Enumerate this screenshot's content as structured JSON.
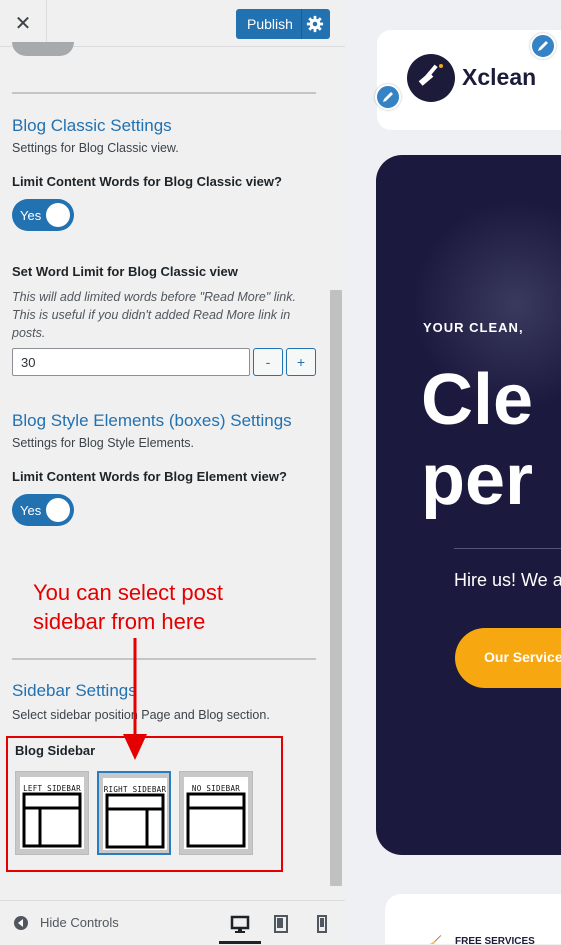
{
  "topbar": {
    "close_glyph": "✕",
    "publish_label": "Publish",
    "gear_icon": "gear-icon"
  },
  "blog_classic": {
    "title": "Blog Classic Settings",
    "description": "Settings for Blog Classic view.",
    "limit_label": "Limit Content Words for Blog Classic view?",
    "limit_toggle": "Yes",
    "word_limit_label": "Set Word Limit for Blog Classic view",
    "word_limit_help_1": "This will add limited words before \"Read More\" link.",
    "word_limit_help_2": "This is useful if you didn't added Read More link in",
    "word_limit_help_3": "posts.",
    "word_limit_value": "30",
    "minus_label": "-",
    "plus_label": "+"
  },
  "blog_style": {
    "title": "Blog Style Elements (boxes) Settings",
    "description": "Settings for Blog Style Elements.",
    "limit_label": "Limit Content Words for Blog Element view?",
    "limit_toggle": "Yes"
  },
  "annotation": {
    "line1": "You can select post",
    "line2": "sidebar from here",
    "color": "#e40000"
  },
  "sidebar": {
    "title": "Sidebar Settings",
    "description": "Select sidebar position Page and Blog section.",
    "blog_sidebar_label": "Blog Sidebar",
    "options": [
      {
        "label": "LEFT SIDEBAR"
      },
      {
        "label": "RIGHT SIDEBAR",
        "selected": true
      },
      {
        "label": "NO SIDEBAR"
      }
    ]
  },
  "bottom": {
    "hide_controls": "Hide Controls",
    "devices": [
      "desktop-icon",
      "tablet-icon",
      "mobile-icon"
    ]
  },
  "preview": {
    "logo_text": "Xclean",
    "tagline": "YOUR CLEAN,",
    "headline_1": "Cle",
    "headline_2": "per",
    "subtitle": "Hire us! We a",
    "cta": "Our Service",
    "free_services": "FREE SERVICES",
    "accent_color": "#f7a70f",
    "hero_color": "#1b1a3e"
  },
  "colors": {
    "wp_blue": "#2271b1"
  }
}
